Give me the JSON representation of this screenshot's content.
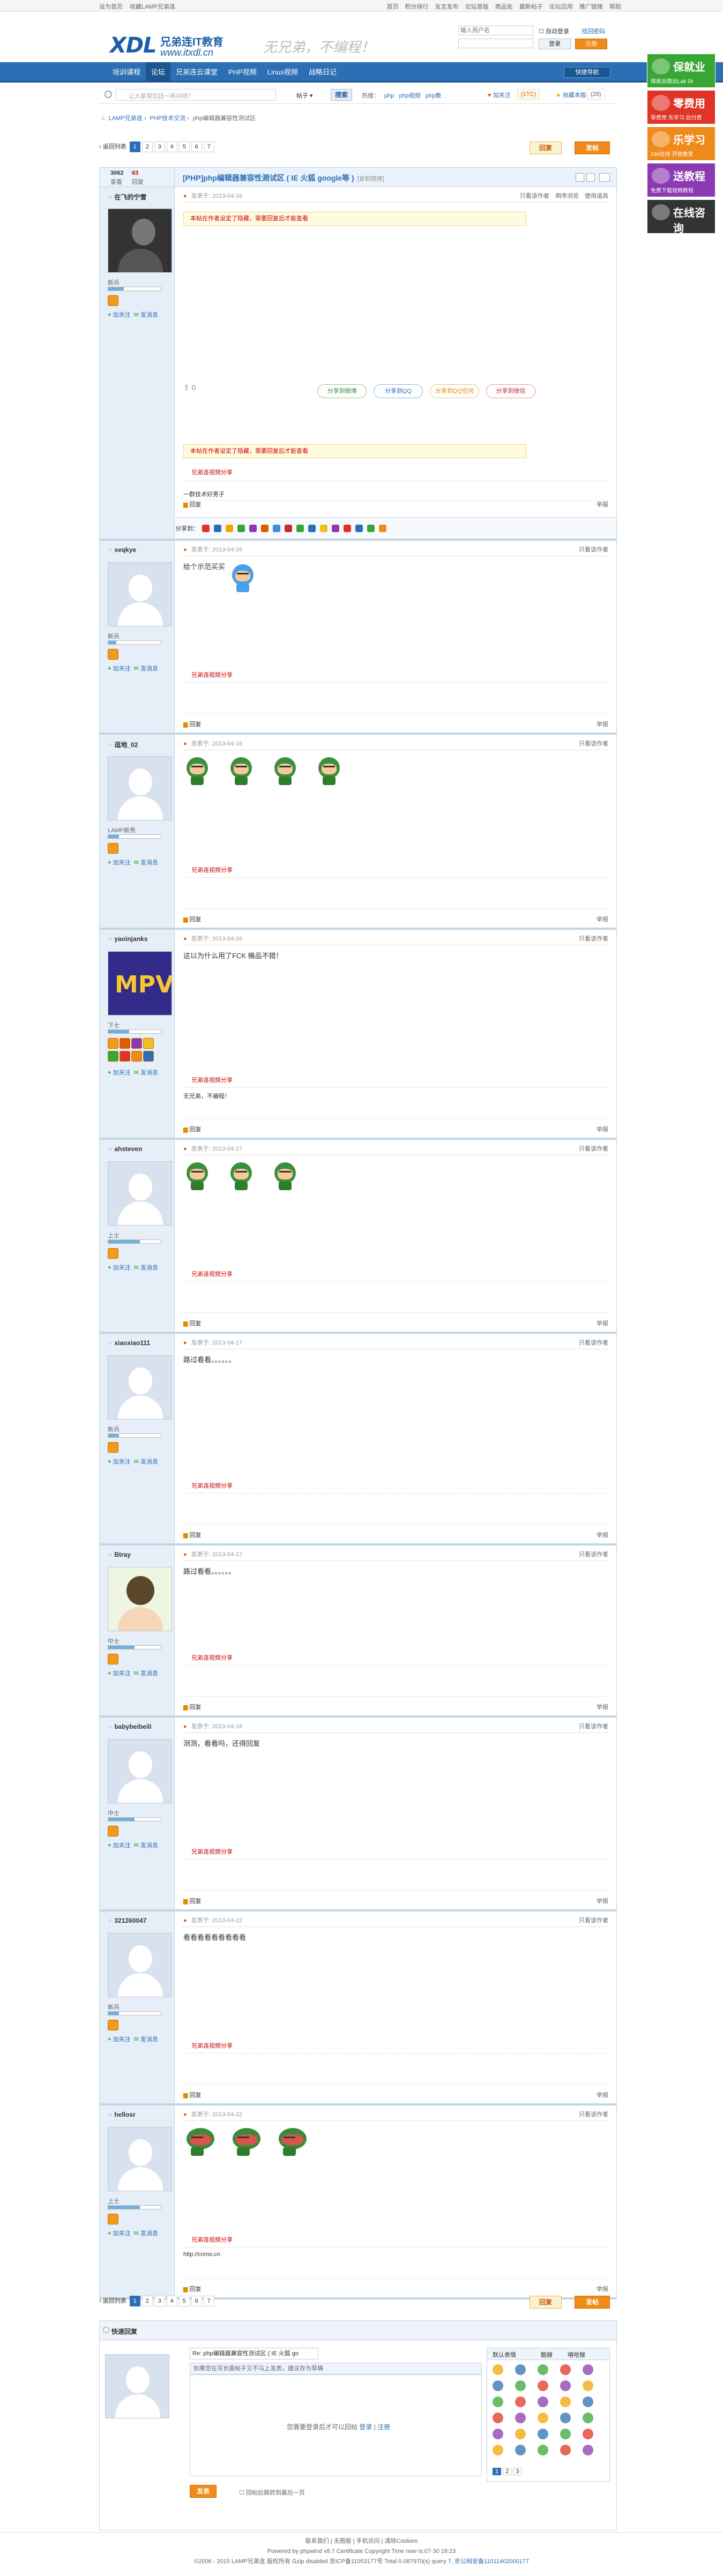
{
  "topbar": {
    "left": [
      "设为首页",
      "收藏LAMP兄弟连"
    ],
    "right": [
      "首页",
      "积分排行",
      "友言发布",
      "论坛首版",
      "商品处",
      "最新帖子",
      "论坛应用",
      "推广链接",
      "帮助"
    ]
  },
  "header": {
    "logo": "XDL",
    "logo_cn": "兄弟连IT教育",
    "logo_url": "www.itxdl.cn",
    "slogan": "无兄弟，不编程！",
    "login": {
      "user_placeholder": "输入用户名",
      "autologin": "自动登录",
      "register": "找回密码",
      "login_btn": "登录",
      "register_btn": "注册"
    }
  },
  "nav": {
    "items": [
      "培训课程",
      "论坛",
      "兄弟连云课堂",
      "PHP视频",
      "Linux视频",
      "战略日记"
    ],
    "quick": "快捷导航"
  },
  "search": {
    "placeholder": "让大家帮您找一两问吧？",
    "type": "帖子",
    "button": "搜索",
    "hot_label": "热搜：",
    "hot": [
      "php",
      "php视频",
      "php教"
    ],
    "follow": "加关注",
    "stats": "(1TC)",
    "fav": "收藏本版",
    "fav_count": "(28)"
  },
  "breadcrumb": [
    "LAMP兄弟连",
    "PHP技术交流",
    "php编辑器兼容性测试区"
  ],
  "pager": {
    "back": "返回列表",
    "pages": [
      "1",
      "2",
      "3",
      "4",
      "5",
      "6",
      "7"
    ],
    "reply": "回复",
    "newthread": "发帖"
  },
  "thread": {
    "views_label": "查看",
    "replies_label": "回复",
    "views": "3062",
    "replies": "63",
    "title": "[PHP]php编辑器兼容性测试区 ( IE 火狐 google等 )",
    "title_extra": "[复制链接]"
  },
  "posts": [
    {
      "user": "在飞的宁雪",
      "rank": "新兵",
      "time": "发表于: 2013-04-16",
      "floor": "",
      "text": "",
      "notice": "本帖在作者设定了隐藏，需要回复后才能查看",
      "hidden": "",
      "footer": "一群技术好男子",
      "level": 0.3,
      "avatar": "real",
      "share": [
        "分享到微博",
        "分享到QQ",
        "分享到QQ空间",
        "分享到微信"
      ],
      "likes": "0"
    },
    {
      "user": "seqkye",
      "rank": "新兵",
      "time": "发表于: 2013-04-16",
      "floor": "只看该作者",
      "text": "给个示范买买",
      "emoji": "blue",
      "level": 0.15
    },
    {
      "user": "逗地_02",
      "rank": "LAMP新秀",
      "time": "发表于: 2013-04-16",
      "floor": "只看该作者",
      "text": "",
      "emoji": "row4",
      "level": 0.2
    },
    {
      "user": "yaoinjanks",
      "rank": "下士",
      "time": "发表于: 2013-04-16",
      "floor": "只看该作者",
      "text": "这以为什么用了FCK 機品不錯！",
      "footer": "无兄弟，不编程！",
      "level": 0.4,
      "avatar": "mpv"
    },
    {
      "user": "ahsteven",
      "rank": "上士",
      "time": "发表于: 2013-04-17",
      "floor": "只看该作者",
      "text": "",
      "emoji": "row3",
      "level": 0.6
    },
    {
      "user": "xiaoxiao111",
      "rank": "新兵",
      "time": "发表于: 2013-04-17",
      "floor": "只看该作者",
      "text": "路过看看。。。。。。",
      "level": 0.2
    },
    {
      "user": "Btray",
      "rank": "中士",
      "time": "发表于: 2013-04-17",
      "floor": "只看该作者",
      "text": "路过看看。。。。。。",
      "level": 0.5,
      "avatar": "girl"
    },
    {
      "user": "babybeibeili",
      "rank": "中士",
      "time": "发表于: 2013-04-18",
      "floor": "只看该作者",
      "text": "测测，看看吗，还得回复",
      "level": 0.5
    },
    {
      "user": "321260047",
      "rank": "新兵",
      "time": "发表于: 2013-04-22",
      "floor": "只看该作者",
      "text": "看看看看看看看看看",
      "level": 0.2
    },
    {
      "user": "hellosr",
      "rank": "上士",
      "time": "发表于: 2013-04-22",
      "floor": "只看该作者",
      "text": "",
      "emoji": "wide3",
      "footer": "http://cnmo.cn",
      "level": 0.6
    }
  ],
  "post_common": {
    "hijack": "兄弟连视频分享",
    "follow": "加关注",
    "msg": "发消息",
    "reply": "回复",
    "report": "举报",
    "ops": [
      "只看该作者",
      "倒序浏览",
      "使用道具"
    ],
    "share_label": "分享到："
  },
  "fastreply": {
    "title": "快速回复",
    "subject": "Re: php编辑器兼容性测试区 ( IE 火狐 go",
    "hint": "如果您在写长篇帖子又不马上发表，建议存为草稿",
    "login_prompt": "您需要登录后才可以回帖",
    "login": "登录",
    "register": "注册",
    "submit": "发表",
    "notify": "回帖后跳转到最后一页",
    "tabs": [
      "默认表情",
      "酷猴",
      "嘻哈猴"
    ],
    "emoji_pages": [
      "1",
      "2",
      "3"
    ]
  },
  "sidead": [
    {
      "big": "保就业",
      "sm": "保就业跳出Lak 5k",
      "color": "#37a635"
    },
    {
      "big": "零费用",
      "sm": "零费用 先学习 后付费",
      "color": "#e03427"
    },
    {
      "big": "乐学习",
      "sm": "24h在线 开放教室",
      "color": "#ef8b1d"
    },
    {
      "big": "送教程",
      "sm": "免费下载视频教程",
      "color": "#8b3ab1"
    },
    {
      "big": "在线咨询",
      "sm": "",
      "color": "#333"
    }
  ],
  "footer": {
    "links": [
      "联系我们",
      "无图版",
      "手机访问",
      "清除Cookies"
    ],
    "powered": "Powered by phpwind v8.7 Certificate Copyright Time now is:07-30 18:23",
    "copy": "©2006 - 2015 LAMP兄弟连 版权所有 Gzip disabled 京ICP备11053177号 Total 0.087970(s) query 7,",
    "icp": "京公网安备11011402000177"
  }
}
